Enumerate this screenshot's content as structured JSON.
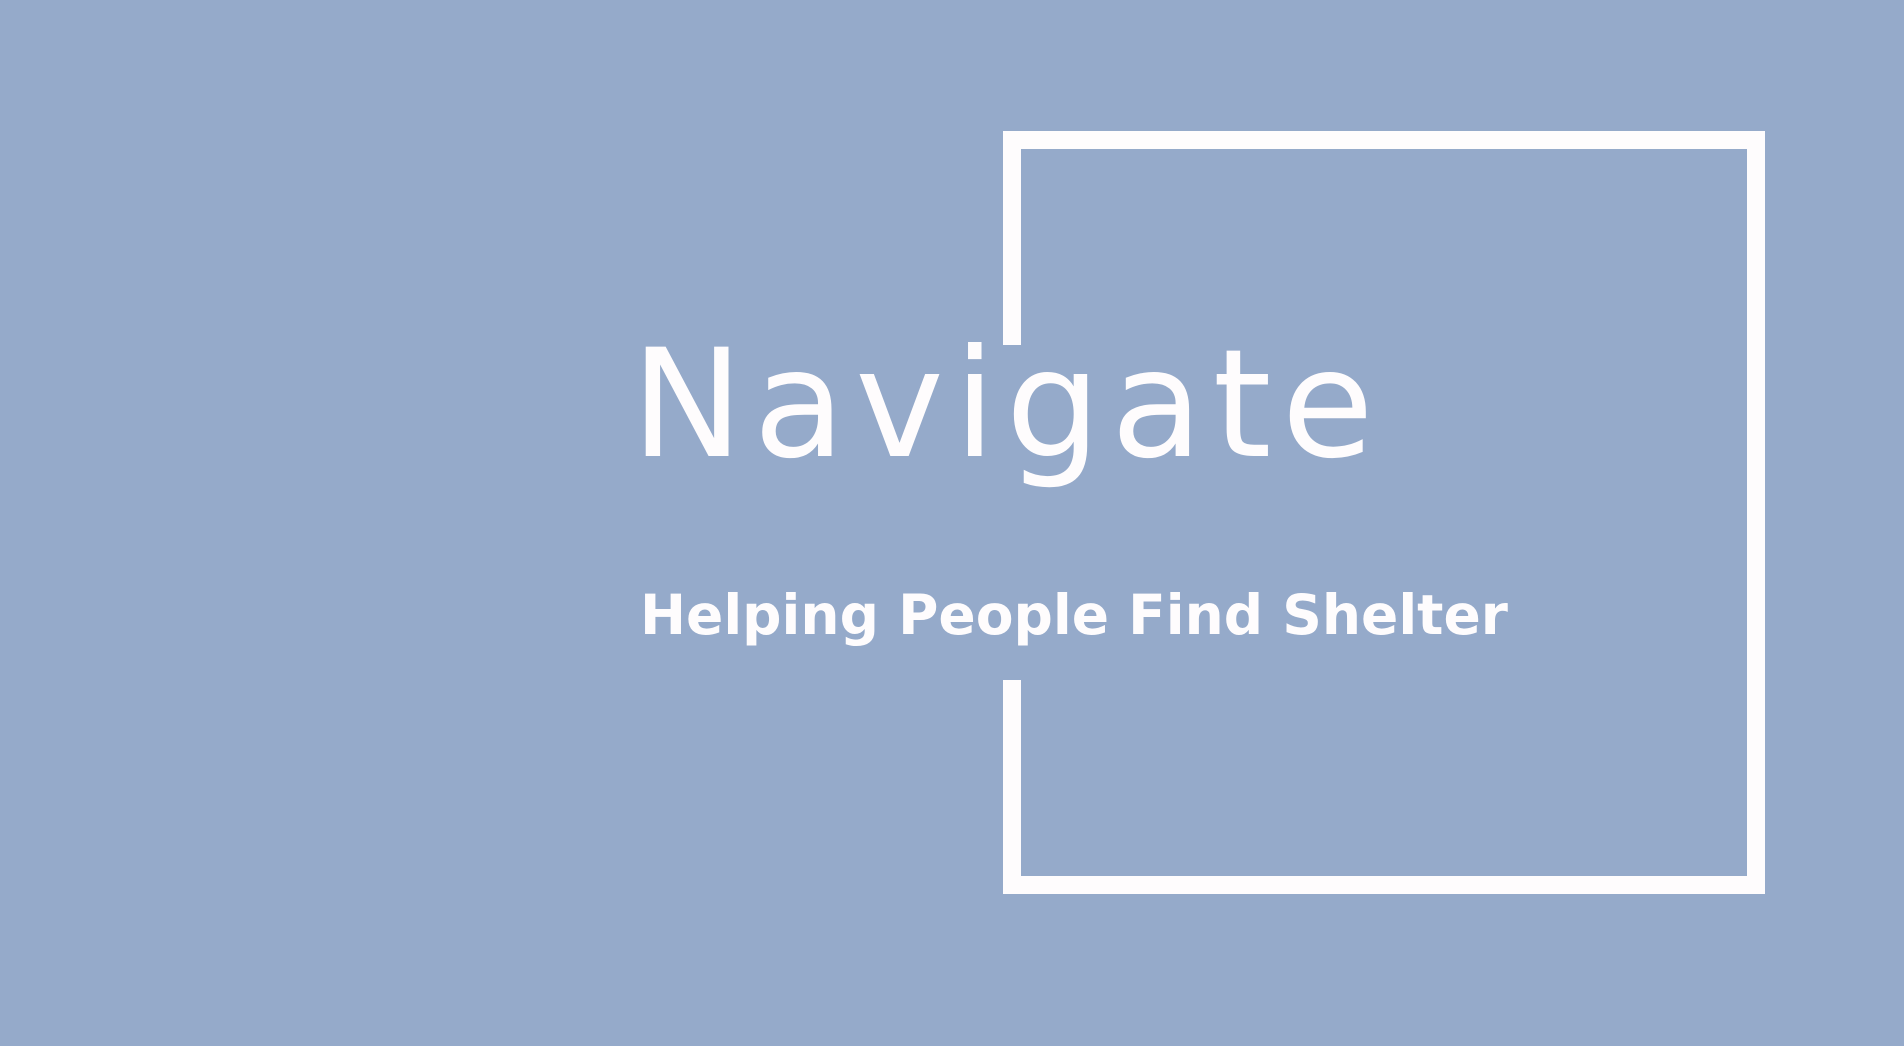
{
  "slide": {
    "title": "Navigate",
    "subtitle": "Helping People Find Shelter"
  },
  "colors": {
    "background": "#95aaca",
    "foreground": "#fefcfd"
  }
}
